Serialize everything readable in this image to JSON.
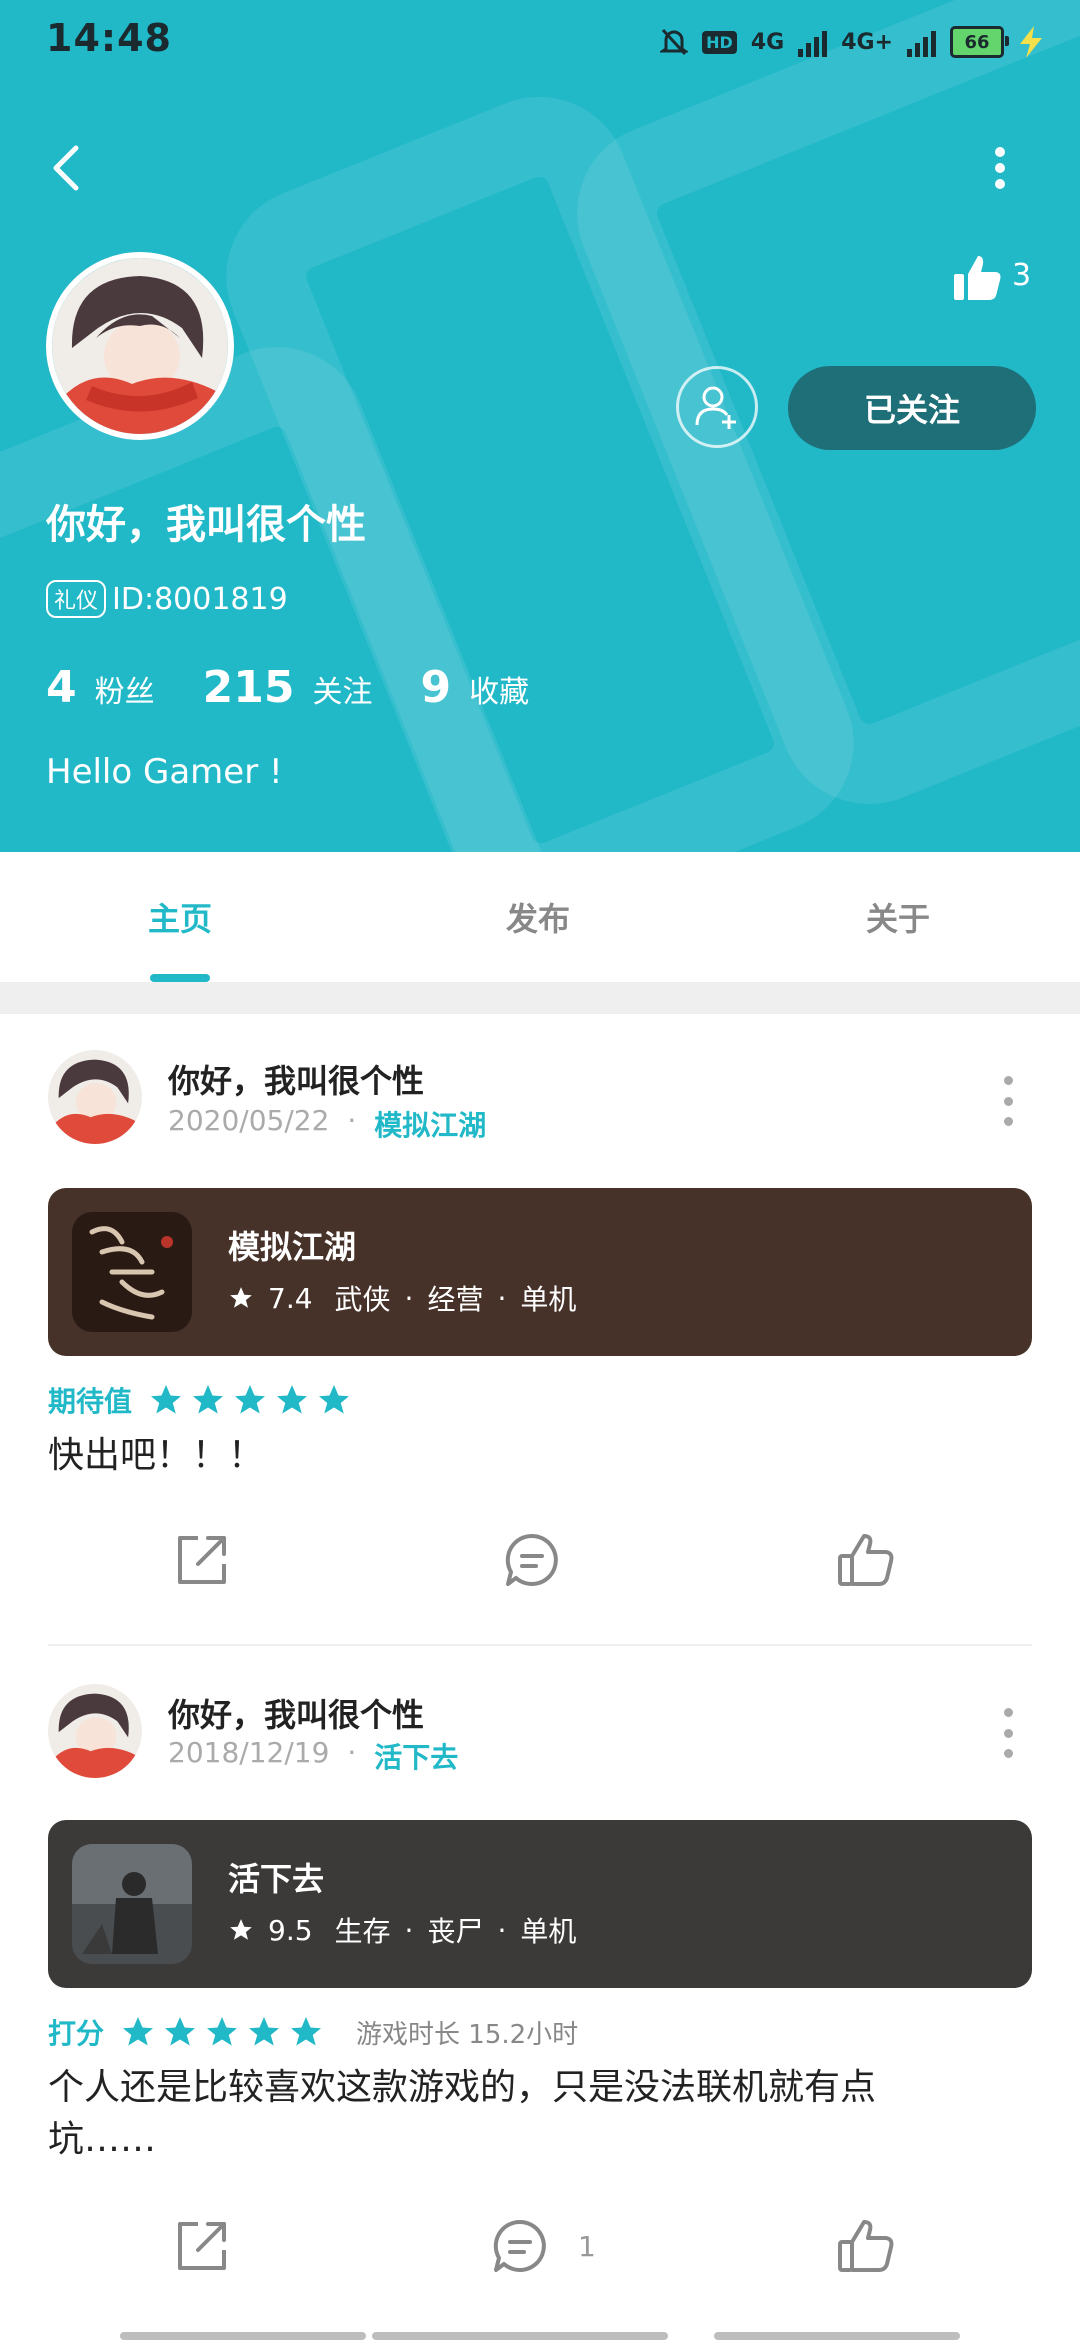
{
  "status_bar": {
    "time": "14:48",
    "battery": "66",
    "network_1": "4G",
    "network_2": "4G+",
    "hd": "HD"
  },
  "profile": {
    "likes": "3",
    "name": "你好，我叫很个性",
    "badge": "礼仪",
    "id": "ID:8001819",
    "stats": [
      {
        "num": "4",
        "label": "粉丝"
      },
      {
        "num": "215",
        "label": "关注"
      },
      {
        "num": "9",
        "label": "收藏"
      }
    ],
    "bio": "Hello Gamer !",
    "follow_label": "已关注"
  },
  "tabs": [
    "主页",
    "发布",
    "关于"
  ],
  "posts": [
    {
      "author": "你好，我叫很个性",
      "date": "2020/05/22",
      "game": "模拟江湖",
      "card": {
        "title": "模拟江湖",
        "score": "7.4",
        "tags": [
          "武侠",
          "经营",
          "单机"
        ],
        "bg": "#47322a"
      },
      "rating_label": "期待值",
      "stars": 5,
      "content": "快出吧！！！"
    },
    {
      "author": "你好，我叫很个性",
      "date": "2018/12/19",
      "game": "活下去",
      "card": {
        "title": "活下去",
        "score": "9.5",
        "tags": [
          "生存",
          "丧尸",
          "单机"
        ],
        "bg": "#3b3a39"
      },
      "rating_label": "打分",
      "stars": 5,
      "duration": "游戏时长 15.2小时",
      "content_line1": "个人还是比较喜欢这款游戏的，只是没法联机就有点",
      "content_line2": "坑……",
      "comment_count": "1"
    }
  ],
  "colors": {
    "accent": "#21b8c8",
    "follow_btn": "#1e6f77"
  }
}
